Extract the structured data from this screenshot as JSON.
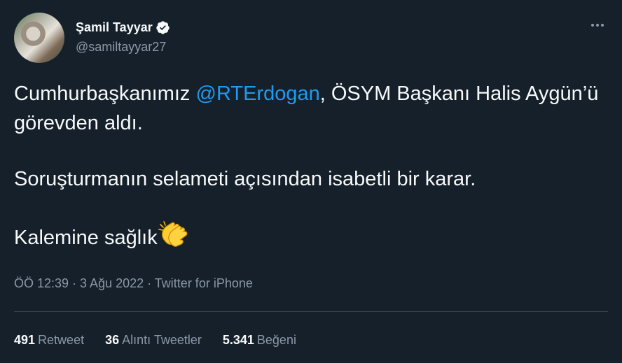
{
  "author": {
    "display_name": "Şamil Tayyar",
    "handle": "@samiltayyar27",
    "verified": true
  },
  "icons": {
    "verified": "verified-badge-icon",
    "more": "more-options-icon",
    "clap": "clapping-hands-emoji"
  },
  "tweet": {
    "line1_before": "Cumhurbaşkanımız ",
    "mention": "@RTErdogan",
    "line1_after": ", ÖSYM Başkanı Halis Aygün’ü görevden aldı.",
    "paragraph2": "Soruşturmanın selameti açısından isabetli bir karar.",
    "paragraph3": "Kalemine sağlık",
    "timestamp": "ÖÖ 12:39 · 3 Ağu 2022 · Twitter for iPhone"
  },
  "stats": {
    "retweets_count": "491",
    "retweets_label": "Retweet",
    "quotes_count": "36",
    "quotes_label": "Alıntı Tweetler",
    "likes_count": "5.341",
    "likes_label": "Beğeni"
  },
  "colors": {
    "background": "#15202b",
    "text": "#f7f9f9",
    "secondary": "#8b98a5",
    "link": "#1d9bf0",
    "divider": "#38444d"
  }
}
